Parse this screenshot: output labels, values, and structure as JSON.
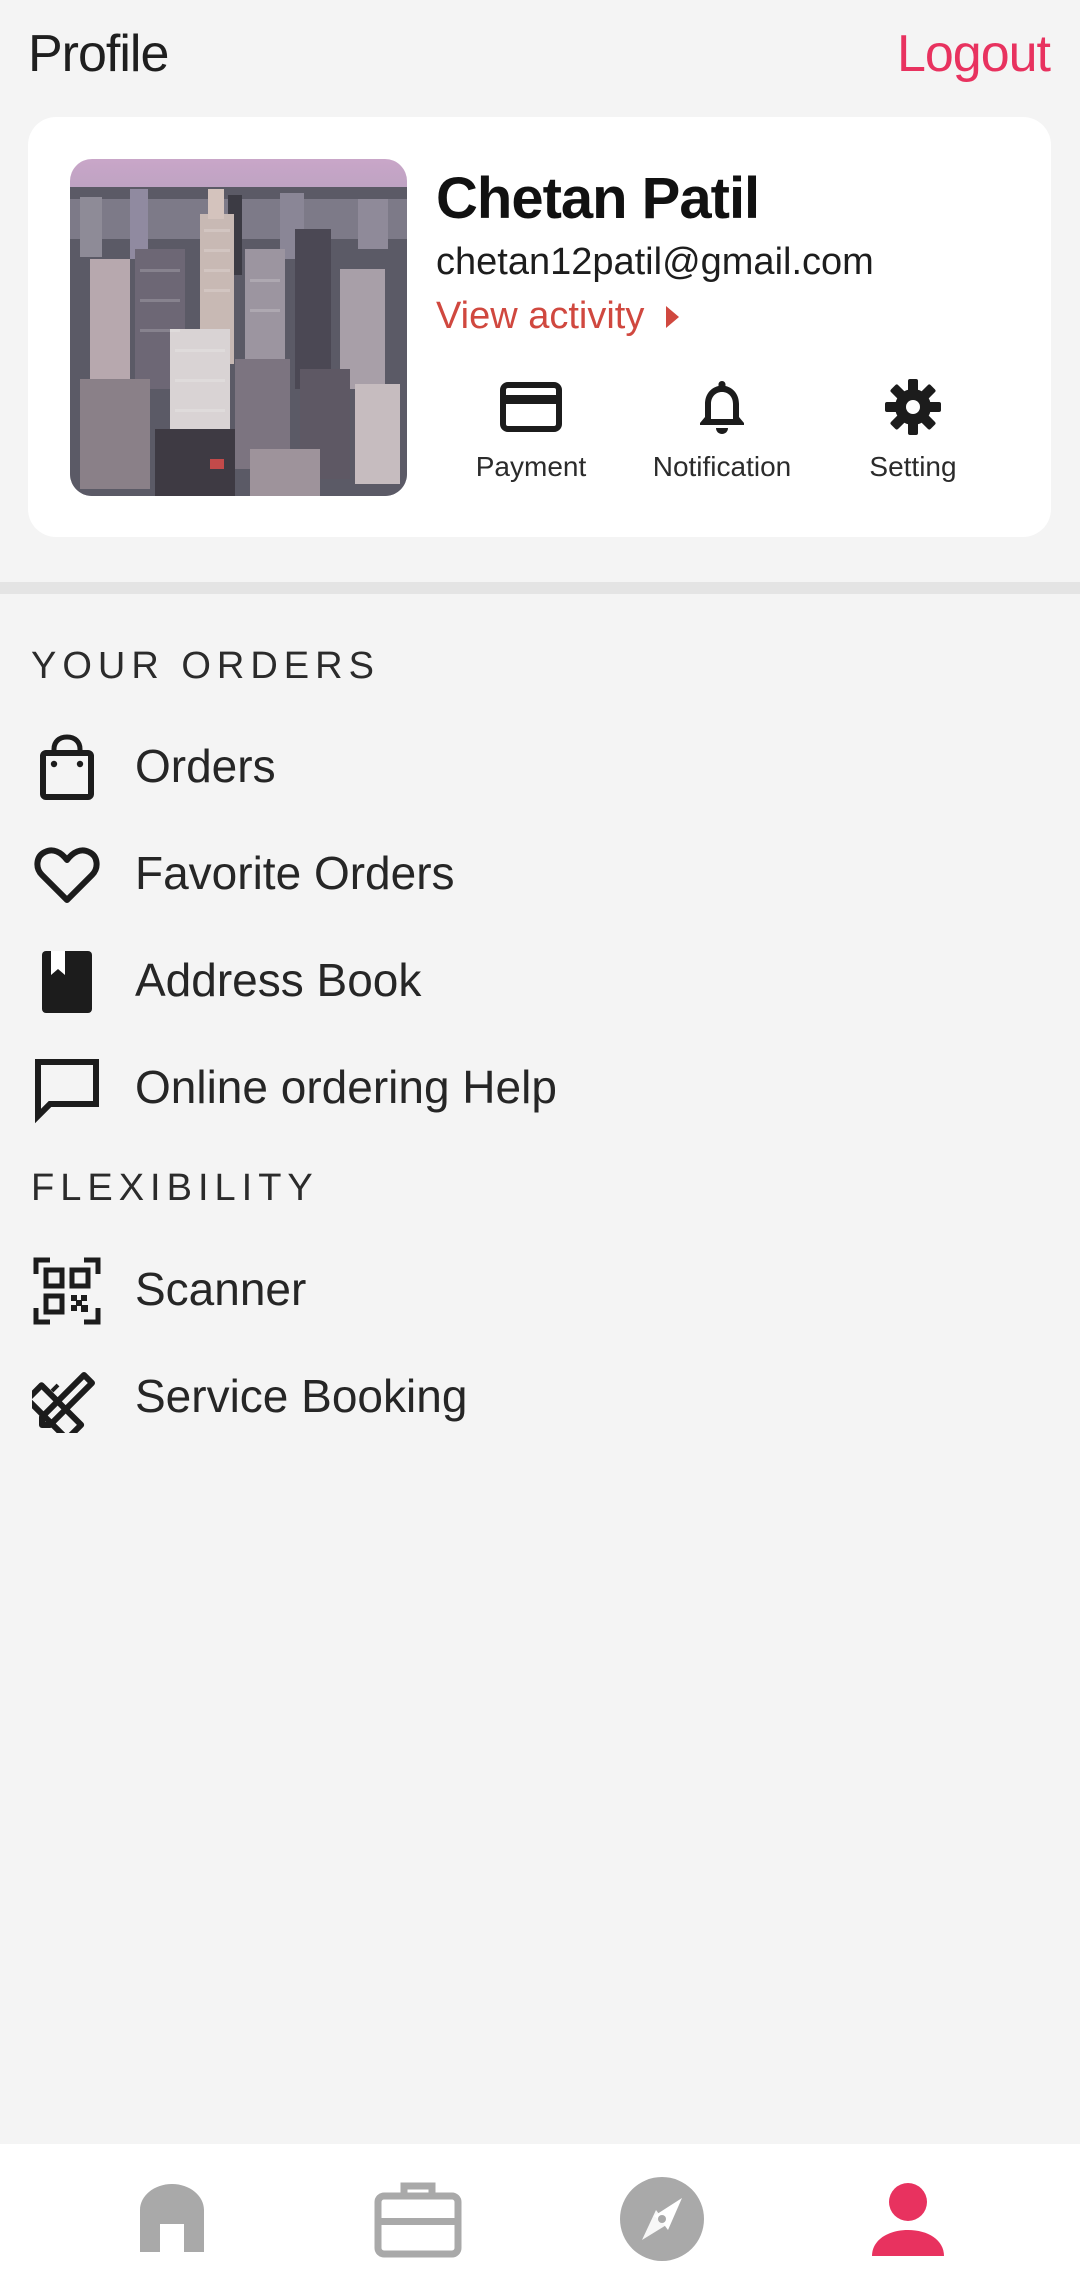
{
  "header": {
    "title": "Profile",
    "logout_label": "Logout"
  },
  "profile": {
    "name": "Chetan Patil",
    "email": "chetan12patil@gmail.com",
    "activity_label": "View activity",
    "quick_actions": [
      {
        "label": "Payment",
        "icon": "credit-card-icon"
      },
      {
        "label": "Notification",
        "icon": "bell-icon"
      },
      {
        "label": "Setting",
        "icon": "gear-icon"
      }
    ]
  },
  "sections": [
    {
      "title": "YOUR ORDERS",
      "items": [
        {
          "label": "Orders",
          "icon": "shopping-bag-icon"
        },
        {
          "label": "Favorite Orders",
          "icon": "heart-icon"
        },
        {
          "label": "Address Book",
          "icon": "book-icon"
        },
        {
          "label": "Online ordering Help",
          "icon": "chat-icon"
        }
      ]
    },
    {
      "title": "FLEXIBILITY",
      "items": [
        {
          "label": "Scanner",
          "icon": "qr-code-icon"
        },
        {
          "label": "Service Booking",
          "icon": "tools-icon"
        }
      ]
    }
  ],
  "bottom_nav": [
    {
      "icon": "home-icon",
      "active": false
    },
    {
      "icon": "briefcase-icon",
      "active": false
    },
    {
      "icon": "compass-icon",
      "active": false
    },
    {
      "icon": "person-icon",
      "active": true
    }
  ],
  "colors": {
    "accent": "#e8325f",
    "activity": "#d0483f",
    "nav_inactive": "#a9a9a9",
    "background": "#f4f4f4"
  }
}
